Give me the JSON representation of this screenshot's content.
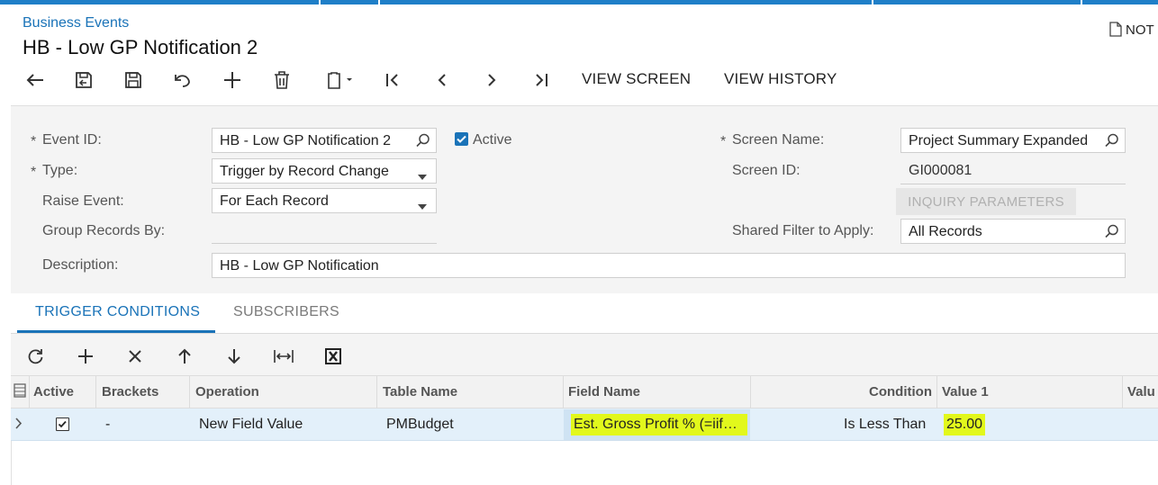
{
  "breadcrumb": "Business Events",
  "page_title": "HB - Low GP Notification 2",
  "notes_label": "NOT",
  "toolbar": {
    "icons": [
      "back-icon",
      "save-close-icon",
      "save-icon",
      "undo-icon",
      "add-icon",
      "delete-icon",
      "clipboard-icon",
      "first-icon",
      "prev-icon",
      "next-icon",
      "last-icon"
    ],
    "view_screen": "VIEW SCREEN",
    "view_history": "VIEW HISTORY"
  },
  "form": {
    "event_id_label": "Event ID:",
    "event_id_value": "HB - Low GP Notification 2",
    "active_label": "Active",
    "active_checked": true,
    "type_label": "Type:",
    "type_value": "Trigger by Record Change",
    "raise_event_label": "Raise Event:",
    "raise_event_value": "For Each Record",
    "group_records_label": "Group Records By:",
    "group_records_value": "",
    "description_label": "Description:",
    "description_value": "HB - Low GP Notification",
    "screen_name_label": "Screen Name:",
    "screen_name_value": "Project Summary Expanded",
    "screen_id_label": "Screen ID:",
    "screen_id_value": "GI000081",
    "inquiry_params_label": "INQUIRY PARAMETERS",
    "shared_filter_label": "Shared Filter to Apply:",
    "shared_filter_value": "All Records",
    "required_marker": "*"
  },
  "tabs": [
    {
      "label": "TRIGGER CONDITIONS",
      "active": true
    },
    {
      "label": "SUBSCRIBERS",
      "active": false
    }
  ],
  "grid": {
    "toolbar_icons": [
      "refresh-icon",
      "add-row-icon",
      "delete-row-icon",
      "move-up-icon",
      "move-down-icon",
      "fit-columns-icon",
      "export-excel-icon"
    ],
    "columns": [
      "Active",
      "Brackets",
      "Operation",
      "Table Name",
      "Field Name",
      "Condition",
      "Value 1",
      "Valu"
    ],
    "rows": [
      {
        "active": true,
        "brackets": "-",
        "operation": "New Field Value",
        "table_name": "PMBudget",
        "field_name": "Est. Gross Profit % (=iif…",
        "condition": "Is Less Than",
        "value1": "25.00"
      }
    ]
  },
  "colors": {
    "accent": "#1a73b8",
    "highlight": "#e2f81c",
    "topbar": "#1f7fc8"
  }
}
